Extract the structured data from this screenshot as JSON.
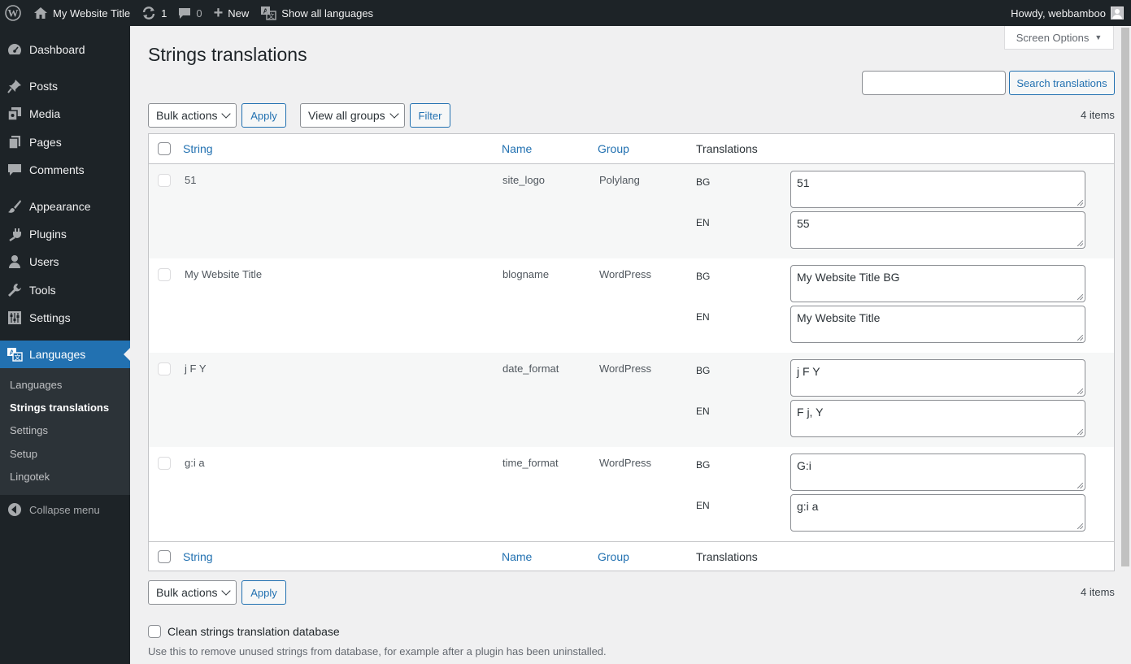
{
  "adminbar": {
    "site_title": "My Website Title",
    "updates_count": "1",
    "comments_count": "0",
    "new_label": "New",
    "languages_label": "Show all languages",
    "howdy": "Howdy, webbamboo"
  },
  "sidebar": {
    "items": [
      {
        "label": "Dashboard"
      },
      {
        "label": "Posts"
      },
      {
        "label": "Media"
      },
      {
        "label": "Pages"
      },
      {
        "label": "Comments"
      },
      {
        "label": "Appearance"
      },
      {
        "label": "Plugins"
      },
      {
        "label": "Users"
      },
      {
        "label": "Tools"
      },
      {
        "label": "Settings"
      },
      {
        "label": "Languages"
      }
    ],
    "submenu": [
      {
        "label": "Languages"
      },
      {
        "label": "Strings translations"
      },
      {
        "label": "Settings"
      },
      {
        "label": "Setup"
      },
      {
        "label": "Lingotek"
      }
    ],
    "collapse_label": "Collapse menu"
  },
  "page": {
    "screen_options": "Screen Options",
    "title": "Strings translations",
    "search_value": "",
    "search_button": "Search translations",
    "bulk_actions": "Bulk actions",
    "apply": "Apply",
    "groups_filter": "View all groups",
    "filter_button": "Filter",
    "items_count": "4 items"
  },
  "table": {
    "columns": {
      "string": "String",
      "name": "Name",
      "group": "Group",
      "translations": "Translations"
    },
    "rows": [
      {
        "string": "51",
        "name": "site_logo",
        "group": "Polylang",
        "translations": [
          {
            "lang": "BG",
            "value": "51"
          },
          {
            "lang": "EN",
            "value": "55"
          }
        ]
      },
      {
        "string": "My Website Title",
        "name": "blogname",
        "group": "WordPress",
        "translations": [
          {
            "lang": "BG",
            "value": "My Website Title BG"
          },
          {
            "lang": "EN",
            "value": "My Website Title"
          }
        ]
      },
      {
        "string": "j F Y",
        "name": "date_format",
        "group": "WordPress",
        "translations": [
          {
            "lang": "BG",
            "value": "j F Y"
          },
          {
            "lang": "EN",
            "value": "F j, Y"
          }
        ]
      },
      {
        "string": "g:i a",
        "name": "time_format",
        "group": "WordPress",
        "translations": [
          {
            "lang": "BG",
            "value": "G:i"
          },
          {
            "lang": "EN",
            "value": "g:i a"
          }
        ]
      }
    ]
  },
  "footer": {
    "clean_label": "Clean strings translation database",
    "clean_help": "Use this to remove unused strings from database, for example after a plugin has been uninstalled."
  }
}
